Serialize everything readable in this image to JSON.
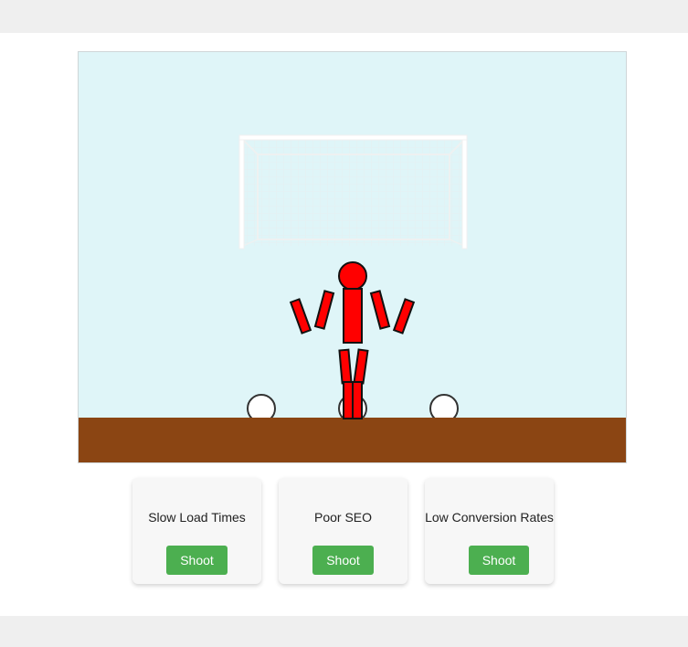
{
  "scene": {
    "sky_color": "#dff5f8",
    "ground_color": "#8b4513",
    "player_color": "#ff0000",
    "ball_count": 3
  },
  "cards": [
    {
      "problem": "Slow Load Times",
      "button": "Shoot"
    },
    {
      "problem": "Poor SEO",
      "button": "Shoot"
    },
    {
      "problem": "Low Conversion Rates",
      "button": "Shoot"
    }
  ],
  "colors": {
    "button_bg": "#4caf50",
    "button_text": "#ffffff"
  }
}
